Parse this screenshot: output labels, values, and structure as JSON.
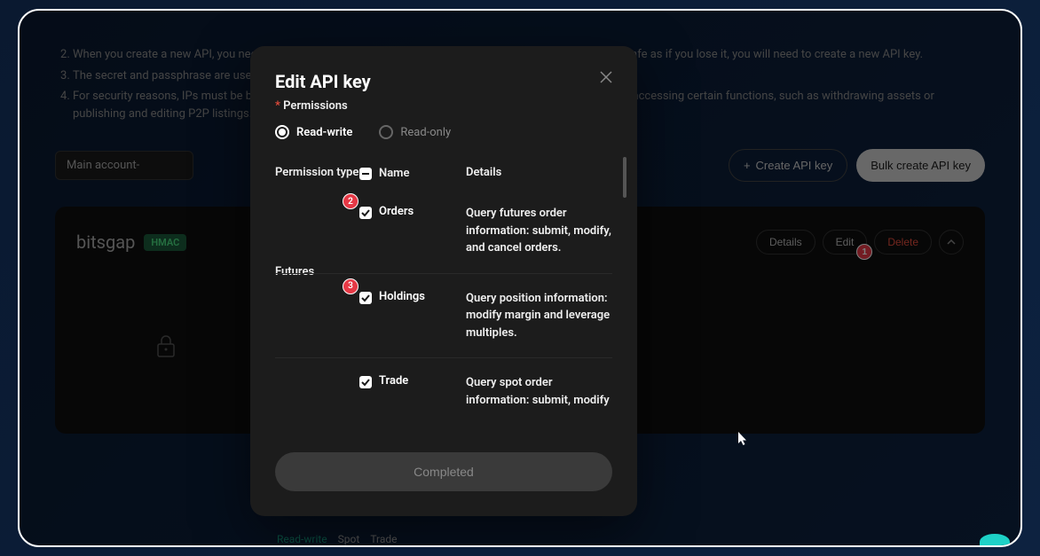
{
  "bg": {
    "list": [
      "When you create a new API, you need to set an API passphrase to access API. Please keep your passphrase safe as if you lose it, you will need to create a new API key.",
      "The secret and passphrase are used for private API calls and trading.",
      "For security reasons, IPs must be bound to API keys and the API without any IP bound may be restricted from accessing certain functions, such as withdrawing assets or publishing and editing P2P listings."
    ],
    "account": "Main account-",
    "create_btn": "Create API key",
    "bulk_btn": "Bulk create API key"
  },
  "card": {
    "name": "bitsgap",
    "hmac": "HMAC",
    "details": "Details",
    "edit": "Edit",
    "delete": "Delete",
    "edit_badge": "1"
  },
  "tags": {
    "rw": "Read-write",
    "spot": "Spot",
    "trade": "Trade"
  },
  "modal": {
    "title": "Edit API key",
    "perm_label": "Permissions",
    "radio_rw": "Read-write",
    "radio_ro": "Read-only",
    "head_type": "Permission type",
    "head_name": "Name",
    "head_details": "Details",
    "section_futures": "Futures",
    "rows": [
      {
        "name": "Orders",
        "details": "Query futures order information: submit, modify, and cancel orders.",
        "badge": "2"
      },
      {
        "name": "Holdings",
        "details": "Query position information: modify margin and leverage multiples.",
        "badge": "3"
      },
      {
        "name": "Trade",
        "details": "Query spot order information: submit, modify"
      }
    ],
    "completed": "Completed"
  }
}
